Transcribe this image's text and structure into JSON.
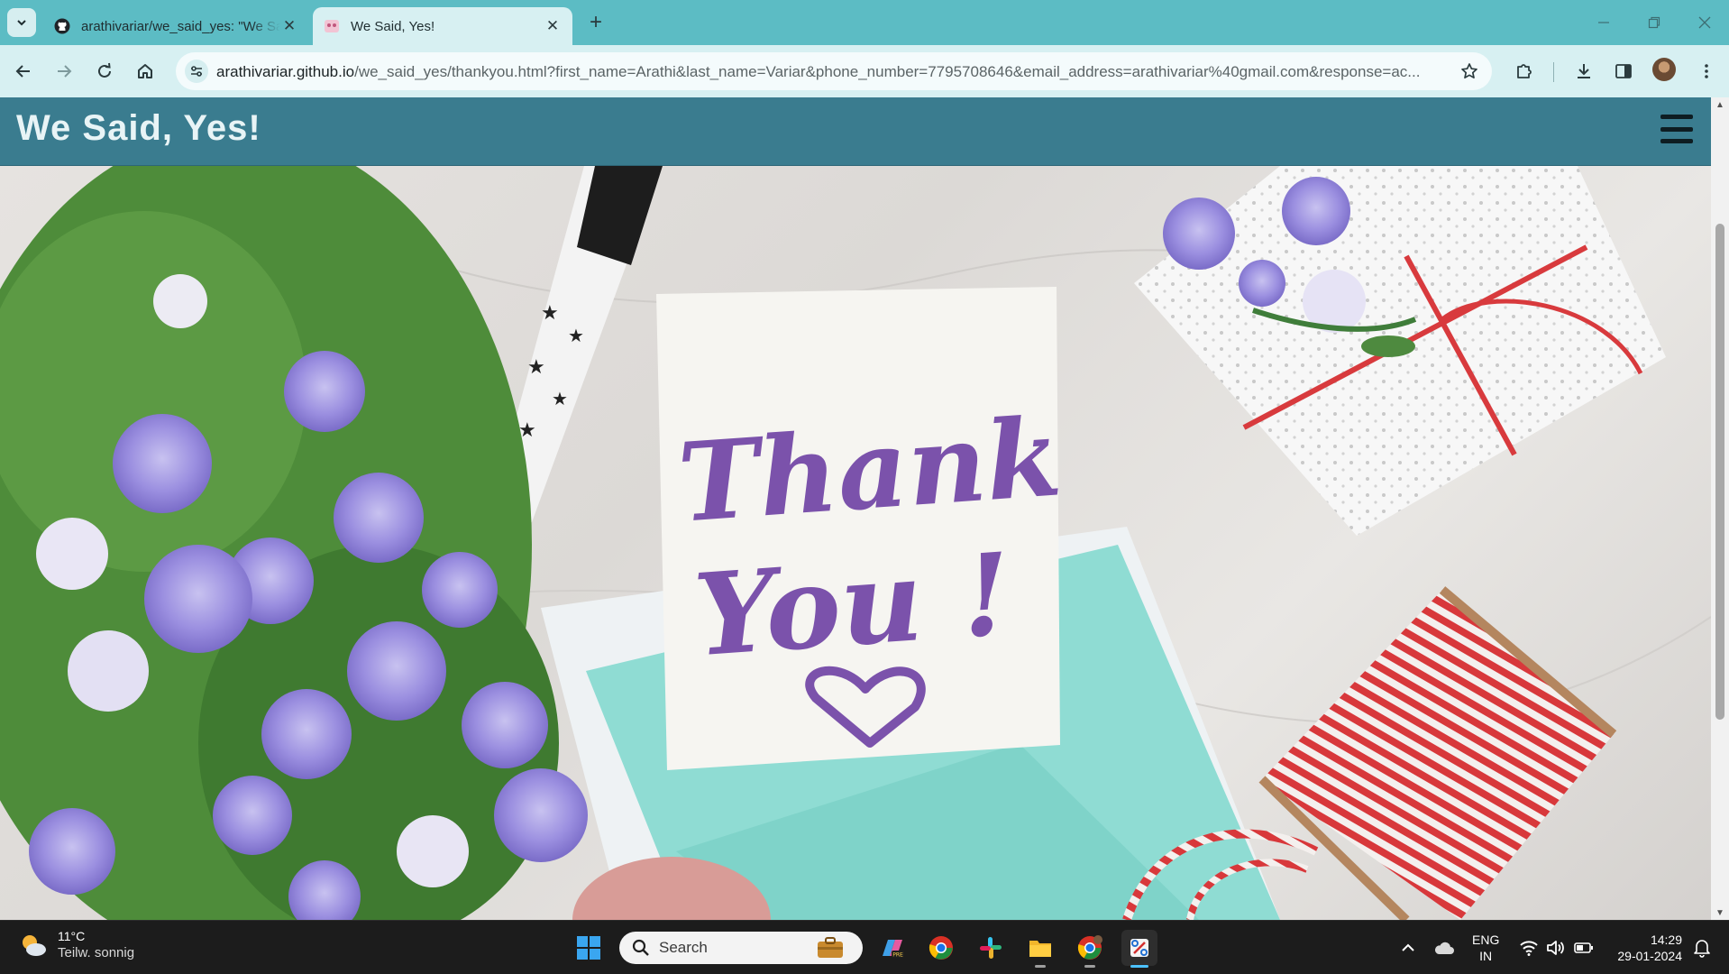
{
  "browser": {
    "tabs": [
      {
        "title": "arathivariar/we_said_yes: \"We Said, Yes!\"",
        "favicon": "github-icon",
        "active": false
      },
      {
        "title": "We Said, Yes!",
        "favicon": "site-favicon",
        "active": true
      }
    ],
    "url_host": "arathivariar.github.io",
    "url_path": "/we_said_yes/thankyou.html?first_name=Arathi&last_name=Variar&phone_number=7795708646&email_address=arathivariar%40gmail.com&response=ac..."
  },
  "page": {
    "brand": "We Said, Yes!",
    "hero_image": "thank-you-card-flatlay",
    "hero_card_text_line1": "Thank",
    "hero_card_text_line2": "You !"
  },
  "taskbar": {
    "weather_temp": "11°C",
    "weather_condition": "Teilw. sonnig",
    "search_placeholder": "Search",
    "lang_line1": "ENG",
    "lang_line2": "IN",
    "time": "14:29",
    "date": "29-01-2024"
  },
  "colors": {
    "tabstrip": "#5cbcc4",
    "toolbar": "#d7f0f2",
    "site_header": "#3a7c8f",
    "card_text": "#7b52ab",
    "envelope": "#8fdcd3"
  }
}
